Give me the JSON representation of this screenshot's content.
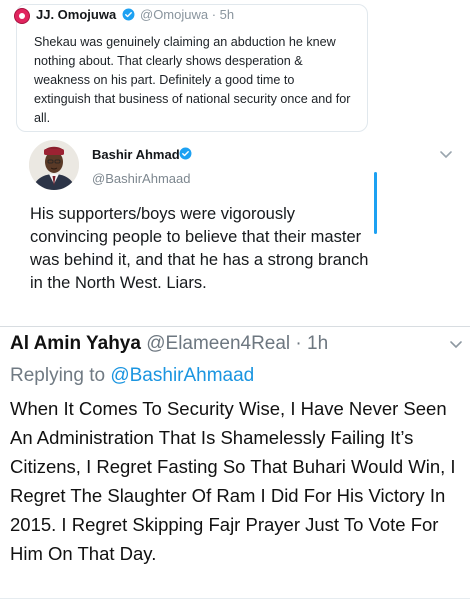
{
  "quoted_tweet": {
    "name": "JJ. Omojuwa",
    "handle_time": "@Omojuwa · 5h",
    "text": "Shekau was genuinely claiming an abduction he knew nothing about. That clearly shows desperation & weakness on his part. Definitely a good time to extinguish that business of national security once and for all."
  },
  "tweet": {
    "name": "Bashir Ahmad",
    "handle": "@BashirAhmaad",
    "text": "His supporters/boys were vigorously convincing people to believe that their master was behind it, and that he has a strong branch in the North West. Liars."
  },
  "reply": {
    "name": "Al Amin Yahya",
    "handle_time": "@Elameen4Real · 1h",
    "replying_prefix": "Replying to",
    "replying_to": "@BashirAhmaad",
    "text": "When It Comes To Security Wise, I Have Never Seen An Administration That Is Shamelessly Failing It’s Citizens, I Regret Fasting So That Buhari Would Win, I Regret The Slaughter Of Ram I Did For His Victory In 2015. I Regret Skipping Fajr Prayer Just To Vote For Him On That Day."
  },
  "colors": {
    "link": "#1b95e0",
    "verified": "#1da1f2",
    "quoted_avatar": "#e0245e"
  },
  "icons": {
    "verified": "verified-badge-icon",
    "caret": "chevron-down-icon"
  }
}
